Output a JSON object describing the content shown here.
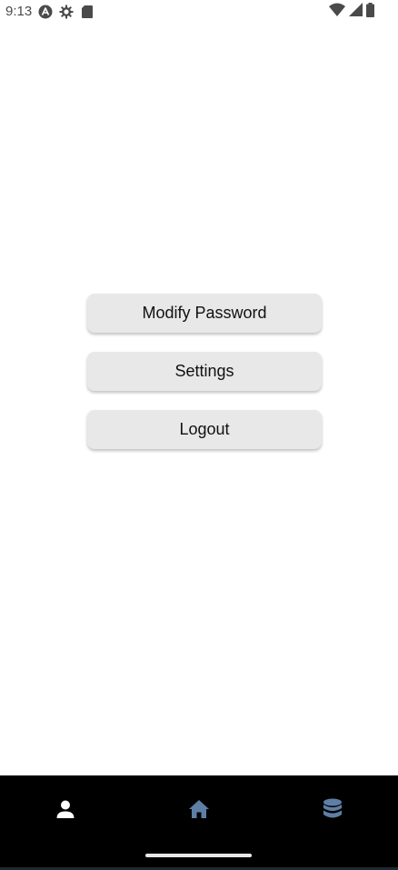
{
  "status_bar": {
    "time": "9:13",
    "left_icons": [
      "app-a-icon",
      "gear-icon",
      "sd-card-icon"
    ],
    "right_icons": [
      "wifi-icon",
      "cell-signal-icon",
      "battery-icon"
    ]
  },
  "menu": {
    "items": [
      {
        "label": "Modify Password"
      },
      {
        "label": "Settings"
      },
      {
        "label": "Logout"
      }
    ]
  },
  "bottom_nav": {
    "items": [
      {
        "icon": "person-icon",
        "active": true,
        "color": "#ffffff"
      },
      {
        "icon": "home-icon",
        "active": false,
        "color": "#5f7ea6"
      },
      {
        "icon": "database-icon",
        "active": false,
        "color": "#5f7ea6"
      }
    ],
    "background": "#000000"
  },
  "colors": {
    "button_bg": "#e8e8e8",
    "text": "#111111",
    "inactive_icon": "#5f7ea6",
    "active_icon": "#ffffff"
  }
}
